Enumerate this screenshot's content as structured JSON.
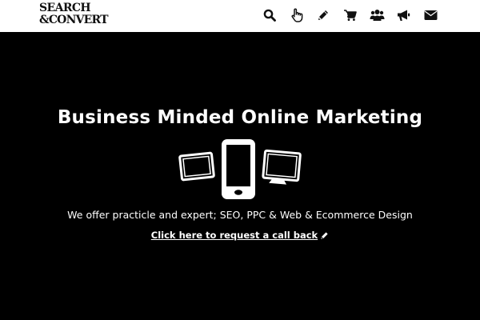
{
  "brand": {
    "logo_line1": "SEARCH",
    "logo_line2": "&CONVERT"
  },
  "nav": {
    "items": [
      {
        "icon": "search-icon"
      },
      {
        "icon": "pointer-hand-icon"
      },
      {
        "icon": "pencil-icon"
      },
      {
        "icon": "shopping-cart-icon"
      },
      {
        "icon": "users-icon"
      },
      {
        "icon": "megaphone-icon"
      },
      {
        "icon": "envelope-icon"
      }
    ]
  },
  "hero": {
    "title": "Business Minded Online Marketing",
    "subtitle": "We offer practicle and expert; SEO, PPC & Web & Ecommerce Design",
    "cta_label": "Click here to request a call back",
    "cta_icon": "pencil-icon",
    "devices_icon": "devices-icon"
  },
  "colors": {
    "header_bg": "#ffffff",
    "hero_bg": "#000000",
    "hero_text": "#ffffff",
    "icon": "#111111"
  }
}
